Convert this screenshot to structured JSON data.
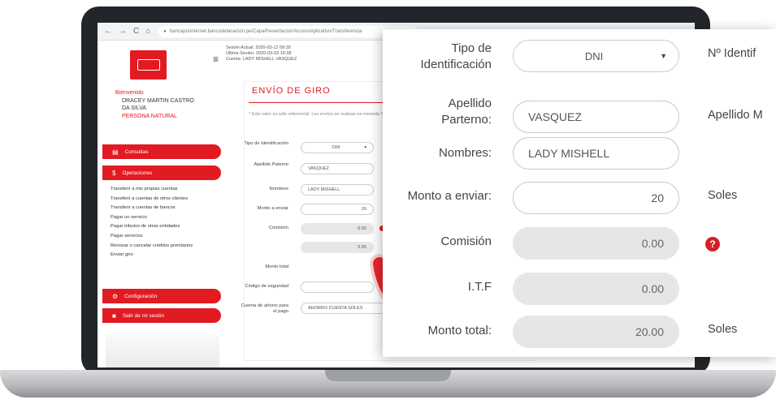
{
  "browser": {
    "nav_back": "←",
    "nav_forward": "→",
    "nav_reload": "C",
    "nav_home": "⌂",
    "url": "bancaporinternet.bancodelanacion.pe/CapaPresentacion/AccesoAplicativo/Transferencia"
  },
  "header": {
    "session_lines": [
      "Sesión Actual: 2020-03-12 09:39",
      "Última Sesión: 2020-03-03 16:38",
      "Cuenta: LADY MISHELL VASQUEZ"
    ]
  },
  "sidebar": {
    "welcome": "Bienvenido",
    "user_name_1": "DRACEY MARTIN CASTRO",
    "user_name_2": "DA SILVA",
    "user_type": "PERSONA NATURAL",
    "menu": [
      {
        "label": "Consultas"
      },
      {
        "label": "Operaciones"
      }
    ],
    "operations": [
      "Transferir a mis propias cuentas",
      "Transferir a cuentas de otros clientes",
      "Transferir a cuentas de bancos",
      "Pagar un servicio",
      "Pagar tributos de otras entidades",
      "Pagar servicios",
      "Renovar o cancelar créditos prendarios",
      "Enviar giro"
    ],
    "bottom_menu": [
      {
        "label": "Configuración"
      },
      {
        "label": "Salir de mi sesión"
      }
    ]
  },
  "form_small": {
    "title": "ENVÍO DE GIRO",
    "note": "* Este valor es sólo referencial. Los envíos se realizan en moneda Soles.",
    "tipo_label": "Tipo de Identificación",
    "tipo_value": "DNI",
    "apellido_label": "Apellido Paterno",
    "apellido_value": "VASQUEZ",
    "nombres_label": "Nombres",
    "nombres_value": "LADY MISHELL",
    "monto_label": "Monto a enviar",
    "monto_value": "20",
    "comision_label": "Comisión",
    "comision_value": "0.00",
    "itf_value": "0.00",
    "total_label": "Monto total",
    "codigo_label": "Código de seguridad",
    "cuenta_label": "Cuenta de ahorro para el pago",
    "cuenta_value": "AHORRO CUENTA SOLES"
  },
  "form_zoom": {
    "tipo_label_1": "Tipo de",
    "tipo_label_2": "Identificación",
    "tipo_value": "DNI",
    "nro_label": "Nº Identif",
    "apellido_label_1": "Apellido",
    "apellido_label_2": "Parterno:",
    "apellido_value": "VASQUEZ",
    "apellido_m_label": "Apellido M",
    "nombres_label": "Nombres:",
    "nombres_value": "LADY MISHELL",
    "monto_label": "Monto a enviar:",
    "monto_value": "20",
    "monto_currency": "Soles",
    "comision_label": "Comisión",
    "comision_value": "0.00",
    "help_glyph": "?",
    "itf_label": "I.T.F",
    "itf_value": "0.00",
    "total_label": "Monto total:",
    "total_value": "20.00",
    "total_currency": "Soles"
  },
  "colors": {
    "brand_red": "#e21a22",
    "arrow_red": "#e8262b"
  }
}
